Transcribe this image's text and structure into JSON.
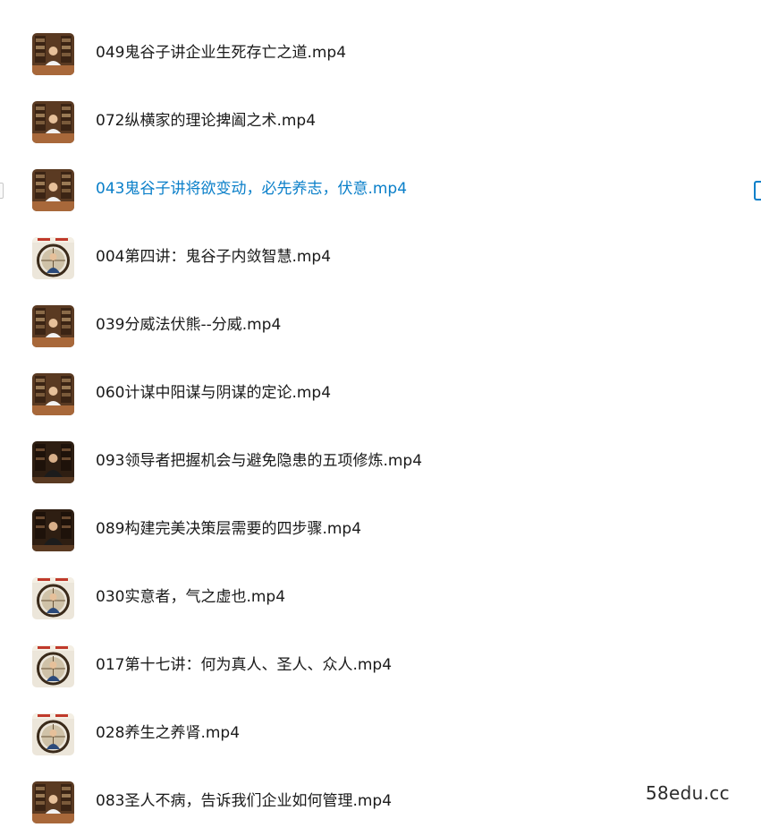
{
  "files": [
    {
      "name": "049鬼谷子讲企业生死存亡之道.mp4",
      "thumbnail": "video-thumbnail-study"
    },
    {
      "name": "072纵横家的理论捭阖之术.mp4",
      "thumbnail": "video-thumbnail-study"
    },
    {
      "name": "043鬼谷子讲将欲变动，必先养志，伏意.mp4",
      "thumbnail": "video-thumbnail-study",
      "selected": true
    },
    {
      "name": "004第四讲：鬼谷子内敛智慧.mp4",
      "thumbnail": "video-thumbnail-round-window"
    },
    {
      "name": "039分威法伏熊--分威.mp4",
      "thumbnail": "video-thumbnail-study"
    },
    {
      "name": "060计谋中阳谋与阴谋的定论.mp4",
      "thumbnail": "video-thumbnail-study"
    },
    {
      "name": "093领导者把握机会与避免隐患的五项修炼.mp4",
      "thumbnail": "video-thumbnail-study-dark"
    },
    {
      "name": "089构建完美决策层需要的四步骤.mp4",
      "thumbnail": "video-thumbnail-study-dark"
    },
    {
      "name": "030实意者，气之虚也.mp4",
      "thumbnail": "video-thumbnail-round-window"
    },
    {
      "name": "017第十七讲：何为真人、圣人、众人.mp4",
      "thumbnail": "video-thumbnail-round-window"
    },
    {
      "name": "028养生之养肾.mp4",
      "thumbnail": "video-thumbnail-round-window"
    },
    {
      "name": "083圣人不病，告诉我们企业如何管理.mp4",
      "thumbnail": "video-thumbnail-study"
    }
  ],
  "watermark": "58edu.cc",
  "colors": {
    "selected_text": "#0a7fc9",
    "normal_text": "#1a1a1a"
  }
}
